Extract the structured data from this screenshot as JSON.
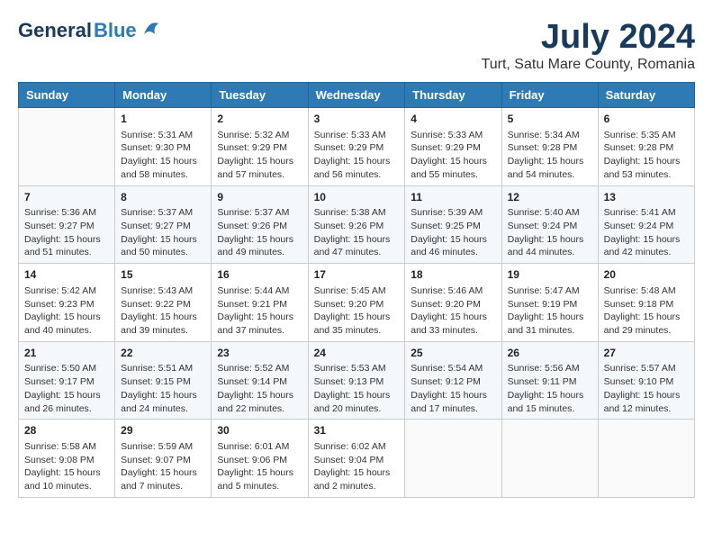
{
  "header": {
    "logo_general": "General",
    "logo_blue": "Blue",
    "month_year": "July 2024",
    "location": "Turt, Satu Mare County, Romania"
  },
  "weekdays": [
    "Sunday",
    "Monday",
    "Tuesday",
    "Wednesday",
    "Thursday",
    "Friday",
    "Saturday"
  ],
  "weeks": [
    [
      {
        "day": "",
        "sunrise": "",
        "sunset": "",
        "daylight": ""
      },
      {
        "day": "1",
        "sunrise": "Sunrise: 5:31 AM",
        "sunset": "Sunset: 9:30 PM",
        "daylight": "Daylight: 15 hours and 58 minutes."
      },
      {
        "day": "2",
        "sunrise": "Sunrise: 5:32 AM",
        "sunset": "Sunset: 9:29 PM",
        "daylight": "Daylight: 15 hours and 57 minutes."
      },
      {
        "day": "3",
        "sunrise": "Sunrise: 5:33 AM",
        "sunset": "Sunset: 9:29 PM",
        "daylight": "Daylight: 15 hours and 56 minutes."
      },
      {
        "day": "4",
        "sunrise": "Sunrise: 5:33 AM",
        "sunset": "Sunset: 9:29 PM",
        "daylight": "Daylight: 15 hours and 55 minutes."
      },
      {
        "day": "5",
        "sunrise": "Sunrise: 5:34 AM",
        "sunset": "Sunset: 9:28 PM",
        "daylight": "Daylight: 15 hours and 54 minutes."
      },
      {
        "day": "6",
        "sunrise": "Sunrise: 5:35 AM",
        "sunset": "Sunset: 9:28 PM",
        "daylight": "Daylight: 15 hours and 53 minutes."
      }
    ],
    [
      {
        "day": "7",
        "sunrise": "Sunrise: 5:36 AM",
        "sunset": "Sunset: 9:27 PM",
        "daylight": "Daylight: 15 hours and 51 minutes."
      },
      {
        "day": "8",
        "sunrise": "Sunrise: 5:37 AM",
        "sunset": "Sunset: 9:27 PM",
        "daylight": "Daylight: 15 hours and 50 minutes."
      },
      {
        "day": "9",
        "sunrise": "Sunrise: 5:37 AM",
        "sunset": "Sunset: 9:26 PM",
        "daylight": "Daylight: 15 hours and 49 minutes."
      },
      {
        "day": "10",
        "sunrise": "Sunrise: 5:38 AM",
        "sunset": "Sunset: 9:26 PM",
        "daylight": "Daylight: 15 hours and 47 minutes."
      },
      {
        "day": "11",
        "sunrise": "Sunrise: 5:39 AM",
        "sunset": "Sunset: 9:25 PM",
        "daylight": "Daylight: 15 hours and 46 minutes."
      },
      {
        "day": "12",
        "sunrise": "Sunrise: 5:40 AM",
        "sunset": "Sunset: 9:24 PM",
        "daylight": "Daylight: 15 hours and 44 minutes."
      },
      {
        "day": "13",
        "sunrise": "Sunrise: 5:41 AM",
        "sunset": "Sunset: 9:24 PM",
        "daylight": "Daylight: 15 hours and 42 minutes."
      }
    ],
    [
      {
        "day": "14",
        "sunrise": "Sunrise: 5:42 AM",
        "sunset": "Sunset: 9:23 PM",
        "daylight": "Daylight: 15 hours and 40 minutes."
      },
      {
        "day": "15",
        "sunrise": "Sunrise: 5:43 AM",
        "sunset": "Sunset: 9:22 PM",
        "daylight": "Daylight: 15 hours and 39 minutes."
      },
      {
        "day": "16",
        "sunrise": "Sunrise: 5:44 AM",
        "sunset": "Sunset: 9:21 PM",
        "daylight": "Daylight: 15 hours and 37 minutes."
      },
      {
        "day": "17",
        "sunrise": "Sunrise: 5:45 AM",
        "sunset": "Sunset: 9:20 PM",
        "daylight": "Daylight: 15 hours and 35 minutes."
      },
      {
        "day": "18",
        "sunrise": "Sunrise: 5:46 AM",
        "sunset": "Sunset: 9:20 PM",
        "daylight": "Daylight: 15 hours and 33 minutes."
      },
      {
        "day": "19",
        "sunrise": "Sunrise: 5:47 AM",
        "sunset": "Sunset: 9:19 PM",
        "daylight": "Daylight: 15 hours and 31 minutes."
      },
      {
        "day": "20",
        "sunrise": "Sunrise: 5:48 AM",
        "sunset": "Sunset: 9:18 PM",
        "daylight": "Daylight: 15 hours and 29 minutes."
      }
    ],
    [
      {
        "day": "21",
        "sunrise": "Sunrise: 5:50 AM",
        "sunset": "Sunset: 9:17 PM",
        "daylight": "Daylight: 15 hours and 26 minutes."
      },
      {
        "day": "22",
        "sunrise": "Sunrise: 5:51 AM",
        "sunset": "Sunset: 9:15 PM",
        "daylight": "Daylight: 15 hours and 24 minutes."
      },
      {
        "day": "23",
        "sunrise": "Sunrise: 5:52 AM",
        "sunset": "Sunset: 9:14 PM",
        "daylight": "Daylight: 15 hours and 22 minutes."
      },
      {
        "day": "24",
        "sunrise": "Sunrise: 5:53 AM",
        "sunset": "Sunset: 9:13 PM",
        "daylight": "Daylight: 15 hours and 20 minutes."
      },
      {
        "day": "25",
        "sunrise": "Sunrise: 5:54 AM",
        "sunset": "Sunset: 9:12 PM",
        "daylight": "Daylight: 15 hours and 17 minutes."
      },
      {
        "day": "26",
        "sunrise": "Sunrise: 5:56 AM",
        "sunset": "Sunset: 9:11 PM",
        "daylight": "Daylight: 15 hours and 15 minutes."
      },
      {
        "day": "27",
        "sunrise": "Sunrise: 5:57 AM",
        "sunset": "Sunset: 9:10 PM",
        "daylight": "Daylight: 15 hours and 12 minutes."
      }
    ],
    [
      {
        "day": "28",
        "sunrise": "Sunrise: 5:58 AM",
        "sunset": "Sunset: 9:08 PM",
        "daylight": "Daylight: 15 hours and 10 minutes."
      },
      {
        "day": "29",
        "sunrise": "Sunrise: 5:59 AM",
        "sunset": "Sunset: 9:07 PM",
        "daylight": "Daylight: 15 hours and 7 minutes."
      },
      {
        "day": "30",
        "sunrise": "Sunrise: 6:01 AM",
        "sunset": "Sunset: 9:06 PM",
        "daylight": "Daylight: 15 hours and 5 minutes."
      },
      {
        "day": "31",
        "sunrise": "Sunrise: 6:02 AM",
        "sunset": "Sunset: 9:04 PM",
        "daylight": "Daylight: 15 hours and 2 minutes."
      },
      {
        "day": "",
        "sunrise": "",
        "sunset": "",
        "daylight": ""
      },
      {
        "day": "",
        "sunrise": "",
        "sunset": "",
        "daylight": ""
      },
      {
        "day": "",
        "sunrise": "",
        "sunset": "",
        "daylight": ""
      }
    ]
  ]
}
